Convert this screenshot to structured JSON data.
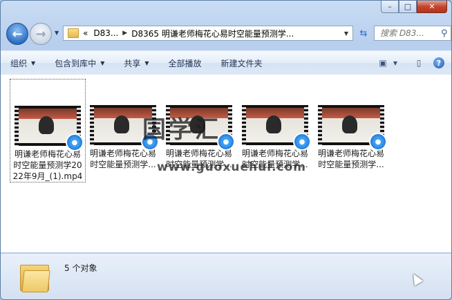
{
  "titlebar": {
    "buttons": {
      "minimize": "–",
      "maximize": "□",
      "close": "✕"
    }
  },
  "nav": {
    "address": {
      "overflow": "«",
      "parent": "D83...",
      "current": "D8365 明谦老师梅花心易时空能量预测学..."
    },
    "search_placeholder": "搜索 D83..."
  },
  "toolbar": {
    "organize": "组织",
    "include_in_library": "包含到库中",
    "share": "共享",
    "play_all": "全部播放",
    "new_folder": "新建文件夹"
  },
  "files": [
    {
      "label": "明谦老师梅花心易时空能量预测学2022年9月_(1).mp4",
      "selected": true
    },
    {
      "label": "明谦老师梅花心易时空能量预测学...",
      "selected": false
    },
    {
      "label": "明谦老师梅花心易时空能量预测学...",
      "selected": false
    },
    {
      "label": "明谦老师梅花心易时空能量预测学...",
      "selected": false
    },
    {
      "label": "明谦老师梅花心易时空能量预测学...",
      "selected": false
    }
  ],
  "watermark": {
    "line1": "国学汇",
    "line2": "www.guoxuehui.com"
  },
  "status": {
    "count": "5 个对象"
  },
  "colors": {
    "frame": "#b8cfee",
    "accent": "#2d6fc4",
    "close": "#c5452c"
  }
}
